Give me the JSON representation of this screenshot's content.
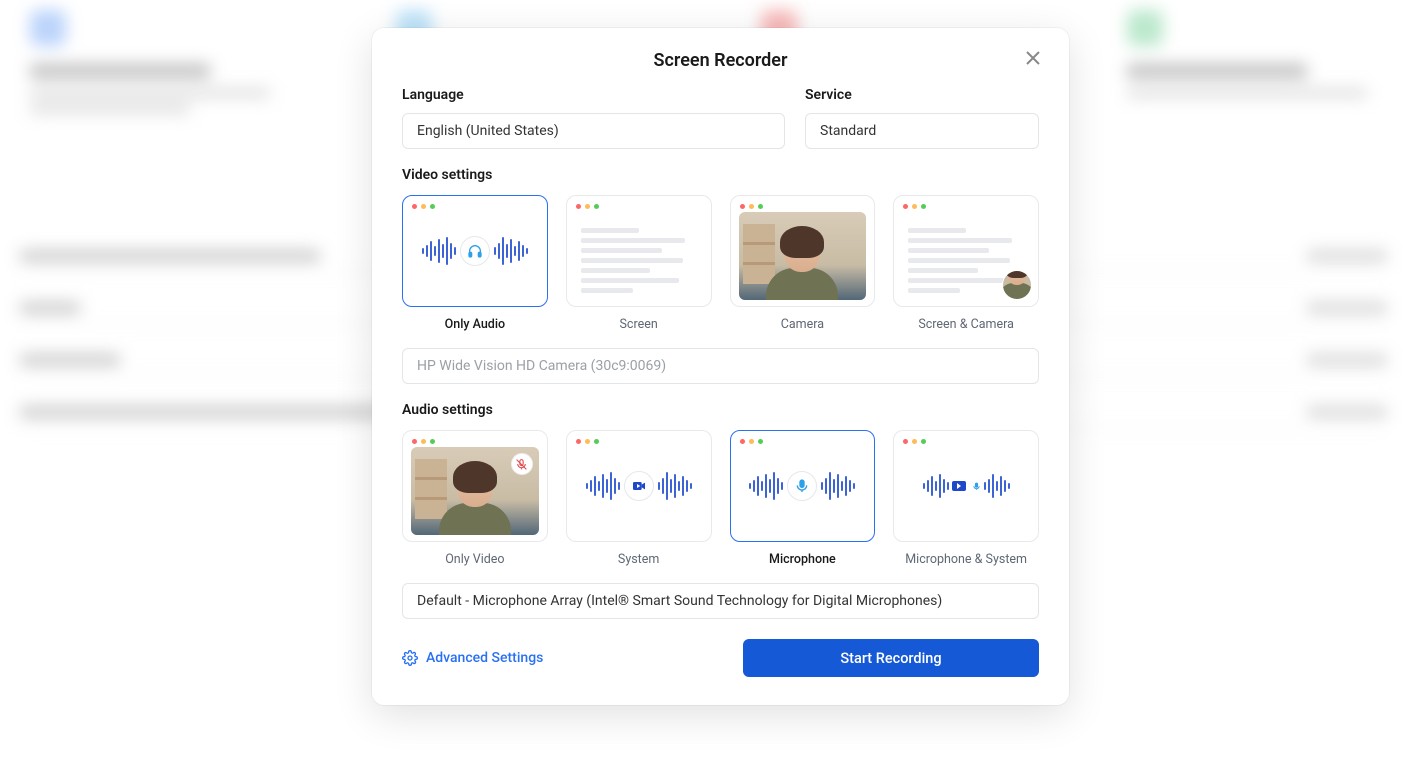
{
  "modal": {
    "title": "Screen Recorder",
    "language_label": "Language",
    "language_value": "English (United States)",
    "service_label": "Service",
    "service_value": "Standard",
    "video_settings_label": "Video settings",
    "video_options": {
      "only_audio": "Only Audio",
      "screen": "Screen",
      "camera": "Camera",
      "screen_camera": "Screen & Camera"
    },
    "camera_device": "HP Wide Vision HD Camera (30c9:0069)",
    "audio_settings_label": "Audio settings",
    "audio_options": {
      "only_video": "Only Video",
      "system": "System",
      "microphone": "Microphone",
      "mic_system": "Microphone & System"
    },
    "mic_device": "Default - Microphone Array (Intel® Smart Sound Technology for Digital Microphones)",
    "advanced_settings": "Advanced Settings",
    "start_recording": "Start Recording"
  }
}
